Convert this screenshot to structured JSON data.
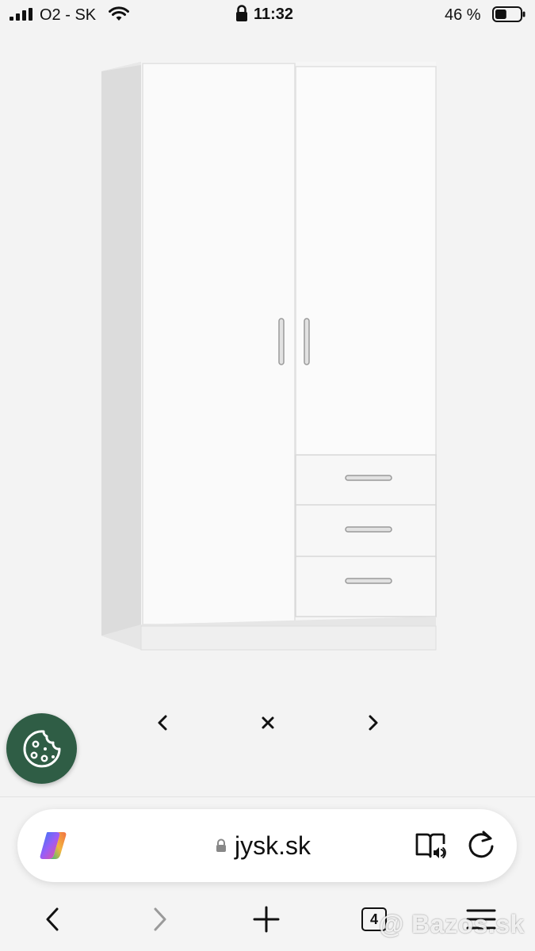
{
  "status_bar": {
    "carrier": "O2 - SK",
    "time": "11:32",
    "battery_percent": "46 %",
    "battery_level": 0.46
  },
  "product": {
    "image_icon": "wardrobe-image"
  },
  "carousel": {
    "prev_glyph": "‹",
    "close_glyph": "✕",
    "next_glyph": "›"
  },
  "cookie": {
    "icon": "cookie-icon",
    "color": "#2f5d45"
  },
  "browser": {
    "url": "jysk.sk",
    "tabs_count": "4"
  },
  "watermark": {
    "text": "@ Bazos.sk"
  }
}
